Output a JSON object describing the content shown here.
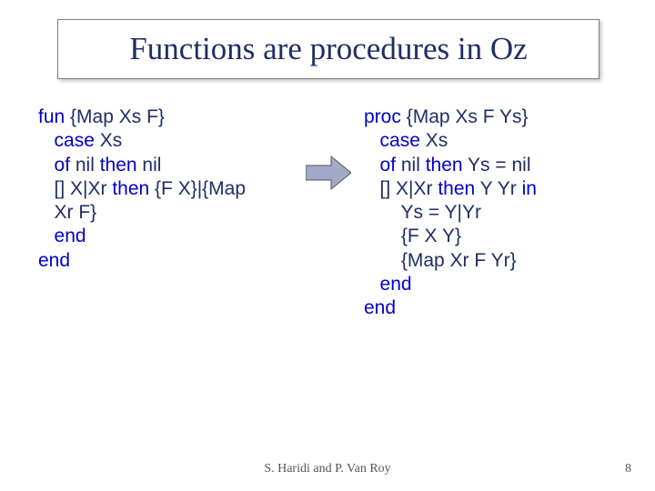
{
  "title": "Functions are procedures in Oz",
  "left_code": {
    "l1a": "fun",
    "l1b": " {Map Xs F}",
    "l2a": "   ",
    "l2b": "case",
    "l2c": " Xs",
    "l3a": "   ",
    "l3b": "of",
    "l3c": " nil ",
    "l3d": "then",
    "l3e": " nil",
    "l4a": "   [] X|Xr ",
    "l4b": "then",
    "l4c": " {F X}|{Map",
    "l5": "   Xr F}",
    "l6a": "   ",
    "l6b": "end",
    "l7": "end"
  },
  "right_code": {
    "l1a": "proc",
    "l1b": " {Map Xs F Ys}",
    "l2a": "   ",
    "l2b": "case",
    "l2c": " Xs",
    "l3a": "   ",
    "l3b": "of",
    "l3c": " nil ",
    "l3d": "then",
    "l3e": " Ys = nil",
    "l4a": "   [] X|Xr ",
    "l4b": "then",
    "l4c": " Y Yr ",
    "l4d": "in",
    "l5": "       Ys = Y|Yr",
    "l6": "       {F X Y}",
    "l7": "       {Map Xr F Yr}",
    "l8a": "   ",
    "l8b": "end",
    "l9": "end"
  },
  "footer": {
    "authors": "S. Haridi and P. Van Roy",
    "page": "8"
  }
}
